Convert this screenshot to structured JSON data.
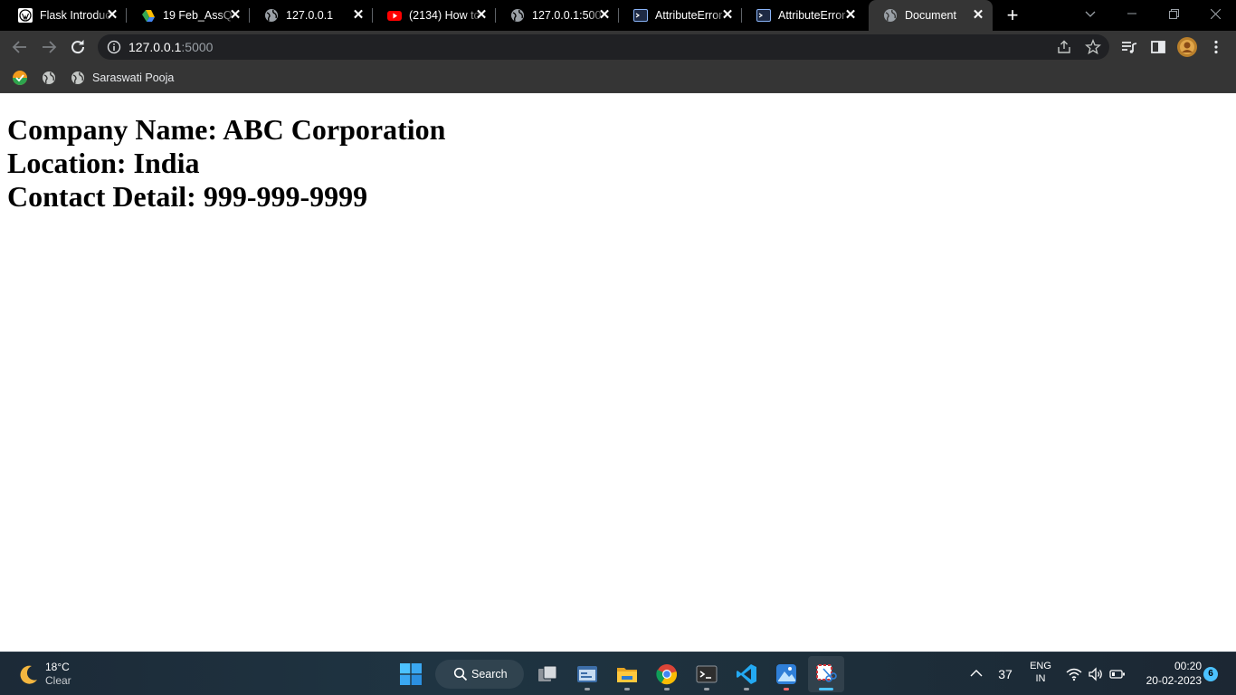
{
  "browser": {
    "tabs": [
      {
        "title": "Flask Introduc",
        "icon": "wordpress-icon"
      },
      {
        "title": "19 Feb_AssQ",
        "icon": "google-drive-icon"
      },
      {
        "title": "127.0.0.1",
        "icon": "globe-icon"
      },
      {
        "title": "(2134) How to",
        "icon": "youtube-icon"
      },
      {
        "title": "127.0.0.1:500",
        "icon": "globe-icon"
      },
      {
        "title": "AttributeError",
        "icon": "terminal-icon"
      },
      {
        "title": "AttributeError",
        "icon": "terminal-icon"
      },
      {
        "title": "Document",
        "icon": "globe-icon"
      }
    ],
    "address": {
      "host": "127.0.0.1",
      "port": ":5000"
    },
    "bookmarks": [
      {
        "label": "",
        "icon": "check-badge-icon"
      },
      {
        "label": "",
        "icon": "globe-icon"
      },
      {
        "label": "Saraswati Pooja",
        "icon": "globe-icon"
      }
    ]
  },
  "page": {
    "lines": [
      "Company Name: ABC Corporation",
      "Location: India",
      "Contact Detail: 999-999-9999"
    ]
  },
  "taskbar": {
    "weather": {
      "temp": "18°C",
      "condition": "Clear"
    },
    "search_label": "Search",
    "tray_count": "37",
    "language": {
      "line1": "ENG",
      "line2": "IN"
    },
    "time": "00:20",
    "date": "20-02-2023",
    "notifications": "6"
  },
  "colors": {
    "tabbar_bg": "#000000",
    "toolbar_bg": "#353535",
    "accent": "#4cc2ff"
  }
}
